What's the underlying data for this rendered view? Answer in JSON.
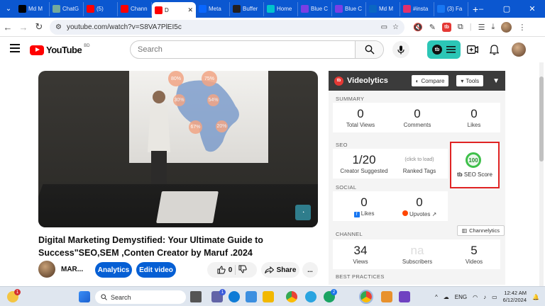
{
  "browser": {
    "tabs": [
      {
        "label": "Md M",
        "icon": "x-logo-icon",
        "color": "#000000"
      },
      {
        "label": "ChatG",
        "icon": "chatgpt-icon",
        "color": "#74aa9c"
      },
      {
        "label": "(5)",
        "icon": "youtube-icon",
        "color": "#ff0000"
      },
      {
        "label": "Chann",
        "icon": "youtube-icon",
        "color": "#ff0000"
      },
      {
        "label": "D",
        "icon": "youtube-icon",
        "color": "#ff0000",
        "active": true
      },
      {
        "label": "Meta",
        "icon": "meta-icon",
        "color": "#0866ff"
      },
      {
        "label": "Buffer",
        "icon": "buffer-icon",
        "color": "#231f20"
      },
      {
        "label": "Home",
        "icon": "canva-icon",
        "color": "#00c4cc"
      },
      {
        "label": "Blue C",
        "icon": "heart-icon",
        "color": "#7b3fe4"
      },
      {
        "label": "Blue C",
        "icon": "heart-icon",
        "color": "#7b3fe4"
      },
      {
        "label": "Md M",
        "icon": "linkedin-icon",
        "color": "#0a66c2"
      },
      {
        "label": "#insta",
        "icon": "instagram-icon",
        "color": "#e1306c"
      },
      {
        "label": "(3) Fa",
        "icon": "facebook-icon",
        "color": "#1877f2"
      }
    ],
    "new_tab": "+",
    "url": "youtube.com/watch?v=S8VA7PlEI5c"
  },
  "youtube": {
    "logo_text": "YouTube",
    "country": "BD",
    "search_placeholder": "Search"
  },
  "video": {
    "title": "Digital Marketing Demystified: Your Ultimate Guide to Success\"SEO,SEM ,Conten Creator by Maruf .2024",
    "channel_name": "MAR...",
    "analytics_label": "Analytics",
    "edit_label": "Edit video",
    "likes": "0",
    "share_label": "Share",
    "more_label": "...",
    "map_bubbles": [
      "80%",
      "75%",
      "30%",
      "54%",
      "67%",
      "20%"
    ]
  },
  "videolytics": {
    "brand": "Videolytics",
    "compare_label": "Compare",
    "tools_label": "Tools",
    "summary": {
      "label": "SUMMARY",
      "total_views": "0",
      "total_views_label": "Total Views",
      "comments": "0",
      "comments_label": "Comments",
      "likes": "0",
      "likes_label": "Likes"
    },
    "seo": {
      "label": "SEO",
      "creator_suggested": "1/20",
      "creator_suggested_label": "Creator Suggested",
      "ranked_tags_hint": "(click to load)",
      "ranked_tags_label": "Ranked Tags",
      "seo_score": "100",
      "seo_score_label": "SEO Score"
    },
    "social": {
      "label": "SOCIAL",
      "fb_likes": "0",
      "fb_likes_label": "Likes",
      "upvotes": "0",
      "upvotes_label": "Upvotes"
    },
    "channel": {
      "label": "CHANNEL",
      "channelytics_label": "Channelytics",
      "views": "34",
      "views_label": "Views",
      "subscribers": "na",
      "subscribers_label": "Subscribers",
      "videos": "5",
      "videos_label": "Videos"
    },
    "best_practices_label": "BEST PRACTICES"
  },
  "taskbar": {
    "search_placeholder": "Search",
    "language": "ENG",
    "time": "12:42 AM",
    "date": "6/12/2024",
    "notification_badge": "1",
    "teams_badge": "1",
    "telegram_badge": "2"
  }
}
